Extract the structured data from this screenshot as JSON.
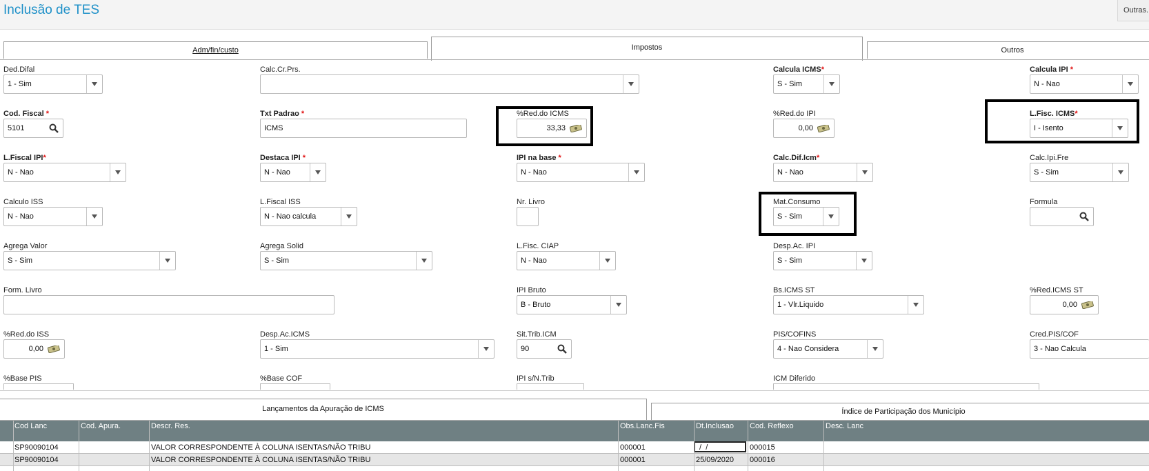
{
  "header": {
    "title": "Inclusão de TES",
    "outras_label": "Outras..."
  },
  "tabs": {
    "adm": "Adm/fin/custo",
    "impostos": "Impostos",
    "outros": "Outros"
  },
  "fields": {
    "ded_difal": {
      "label": "Ded.Difal",
      "value": "1 - Sim"
    },
    "calc_cr_prs": {
      "label": "Calc.Cr.Prs.",
      "value": ""
    },
    "calcula_icms": {
      "label": "Calcula ICMS",
      "value": "S - Sim"
    },
    "calcula_ipi": {
      "label": "Calcula IPI",
      "value": "N - Nao"
    },
    "cod_fiscal": {
      "label": "Cod. Fiscal",
      "value": "5101"
    },
    "txt_padrao": {
      "label": "Txt Padrao",
      "value": "ICMS"
    },
    "red_icms": {
      "label": "%Red.do ICMS",
      "value": "33,33"
    },
    "red_ipi": {
      "label": "%Red.do IPI",
      "value": "0,00"
    },
    "lfisc_icms": {
      "label": "L.Fisc. ICMS",
      "value": "I - Isento"
    },
    "lfiscal_ipi": {
      "label": "L.Fiscal IPI",
      "value": "N - Nao"
    },
    "destaca_ipi": {
      "label": "Destaca IPI",
      "value": "N - Nao"
    },
    "ipi_na_base": {
      "label": "IPI na base",
      "value": "N - Nao"
    },
    "calc_dif_icm": {
      "label": "Calc.Dif.Icm",
      "value": "N - Nao"
    },
    "calc_ipi_fre": {
      "label": "Calc.Ipi.Fre",
      "value": "S - Sim"
    },
    "calculo_iss": {
      "label": "Calculo ISS",
      "value": "N - Nao"
    },
    "lfiscal_iss": {
      "label": "L.Fiscal ISS",
      "value": "N - Nao calcula"
    },
    "nr_livro": {
      "label": "Nr. Livro",
      "value": ""
    },
    "mat_consumo": {
      "label": "Mat.Consumo",
      "value": "S - Sim"
    },
    "formula": {
      "label": "Formula",
      "value": ""
    },
    "agrega_valor": {
      "label": "Agrega Valor",
      "value": "S - Sim"
    },
    "agrega_solid": {
      "label": "Agrega Solid",
      "value": "S - Sim"
    },
    "lfisc_ciap": {
      "label": "L.Fisc. CIAP",
      "value": "N - Nao"
    },
    "desp_ac_ipi": {
      "label": "Desp.Ac. IPI",
      "value": "S - Sim"
    },
    "form_livro": {
      "label": "Form. Livro",
      "value": ""
    },
    "ipi_bruto": {
      "label": "IPI Bruto",
      "value": "B - Bruto"
    },
    "bs_icms_st": {
      "label": "Bs.ICMS ST",
      "value": "1 - Vlr.Liquido"
    },
    "red_icms_st": {
      "label": "%Red.ICMS ST",
      "value": "0,00"
    },
    "red_iss": {
      "label": "%Red.do ISS",
      "value": "0,00"
    },
    "desp_ac_icms": {
      "label": "Desp.Ac.ICMS",
      "value": "1 - Sim"
    },
    "sit_trib_icm": {
      "label": "Sit.Trib.ICM",
      "value": "90"
    },
    "pis_cofins": {
      "label": "PIS/COFINS",
      "value": "4 - Nao Considera"
    },
    "cred_pis_cof": {
      "label": "Cred.PIS/COF",
      "value": "3 - Nao Calcula"
    },
    "base_pis": {
      "label": "%Base PIS"
    },
    "base_cof": {
      "label": "%Base COF"
    },
    "ipi_sn_trib": {
      "label": "IPI s/N.Trib"
    },
    "icm_diferido": {
      "label": "ICM Diferido"
    }
  },
  "bottom_tabs": {
    "lancamentos": "Lançamentos da Apuração de ICMS",
    "indice": "Índice de Participação dos Município"
  },
  "grid": {
    "headers": [
      "Cod Lanc",
      "Cod. Apura.",
      "Descr. Res.",
      "Obs.Lanc.Fis",
      "Dt.Inclusao",
      "Cod. Reflexo",
      "Desc. Lanc"
    ],
    "rows": [
      [
        "SP90090104",
        "",
        "VALOR CORRESPONDENTE À COLUNA ISENTAS/NÃO TRIBU",
        "000001",
        " /  /",
        "000015",
        ""
      ],
      [
        "SP90090104",
        "",
        "VALOR CORRESPONDENTE À COLUNA ISENTAS/NÃO TRIBU",
        "000001",
        "25/09/2020",
        "000016",
        ""
      ]
    ]
  },
  "colors": {
    "accent": "#1e90c8",
    "grid_header": "#6f8083",
    "required": "#e01010"
  }
}
